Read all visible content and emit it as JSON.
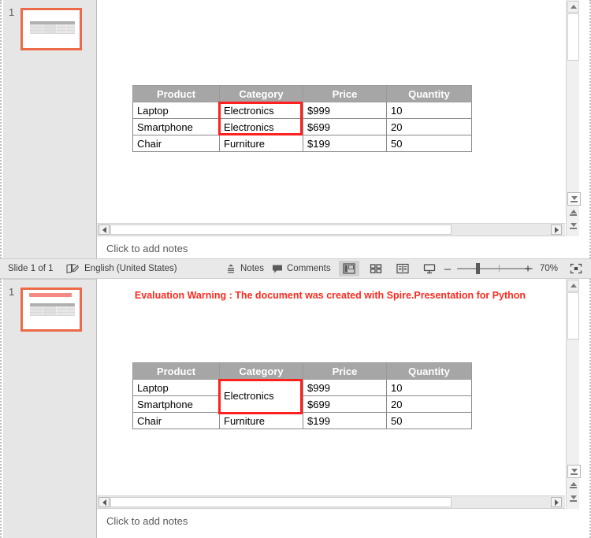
{
  "app": {
    "title": "PowerPoint slide editor (two stacked views)"
  },
  "panels": [
    {
      "id": "top",
      "thumbnail": {
        "number": "1",
        "has_warning_text": false
      },
      "slide": {
        "warning": "",
        "table": {
          "headers": [
            "Product",
            "Category",
            "Price",
            "Quantity"
          ],
          "rows": [
            [
              "Laptop",
              "Electronics",
              "$999",
              "10"
            ],
            [
              "Smartphone",
              "Electronics",
              "$699",
              "20"
            ],
            [
              "Chair",
              "Furniture",
              "$199",
              "50"
            ]
          ],
          "merged_category": false,
          "selection_note": "red box around Category cells rows 1-2"
        }
      },
      "notes_placeholder": "Click to add notes"
    },
    {
      "id": "bottom",
      "thumbnail": {
        "number": "1",
        "has_warning_text": true
      },
      "slide": {
        "warning": "Evaluation Warning : The document was created with Spire.Presentation for Python",
        "table": {
          "headers": [
            "Product",
            "Category",
            "Price",
            "Quantity"
          ],
          "rows": [
            [
              "Laptop",
              "Electronics",
              "$999",
              "10"
            ],
            [
              "Smartphone",
              "",
              "$699",
              "20"
            ],
            [
              "Chair",
              "Furniture",
              "$199",
              "50"
            ]
          ],
          "merged_category": true,
          "merged_category_value": "Electronics",
          "selection_note": "red box around merged Category cell"
        }
      },
      "notes_placeholder": "Click to add notes"
    }
  ],
  "statusbar": {
    "slide_indicator": "Slide 1 of 1",
    "language": "English (United States)",
    "notes_label": "Notes",
    "comments_label": "Comments",
    "zoom_level": "70%",
    "view_buttons": [
      {
        "name": "normal-view",
        "active": true
      },
      {
        "name": "slide-sorter-view",
        "active": false
      },
      {
        "name": "reading-view",
        "active": false
      },
      {
        "name": "slideshow-view",
        "active": false
      }
    ],
    "zoom_out_label": "–",
    "zoom_in_label": "+"
  },
  "colors": {
    "accent_selection": "#ed6a49",
    "table_header_bg": "#a6a6a6",
    "warning_red": "#ff2a1f",
    "selection_red": "#ff2020",
    "chrome_bg": "#e9e9e9",
    "rail_bg": "#e6e6e6"
  }
}
